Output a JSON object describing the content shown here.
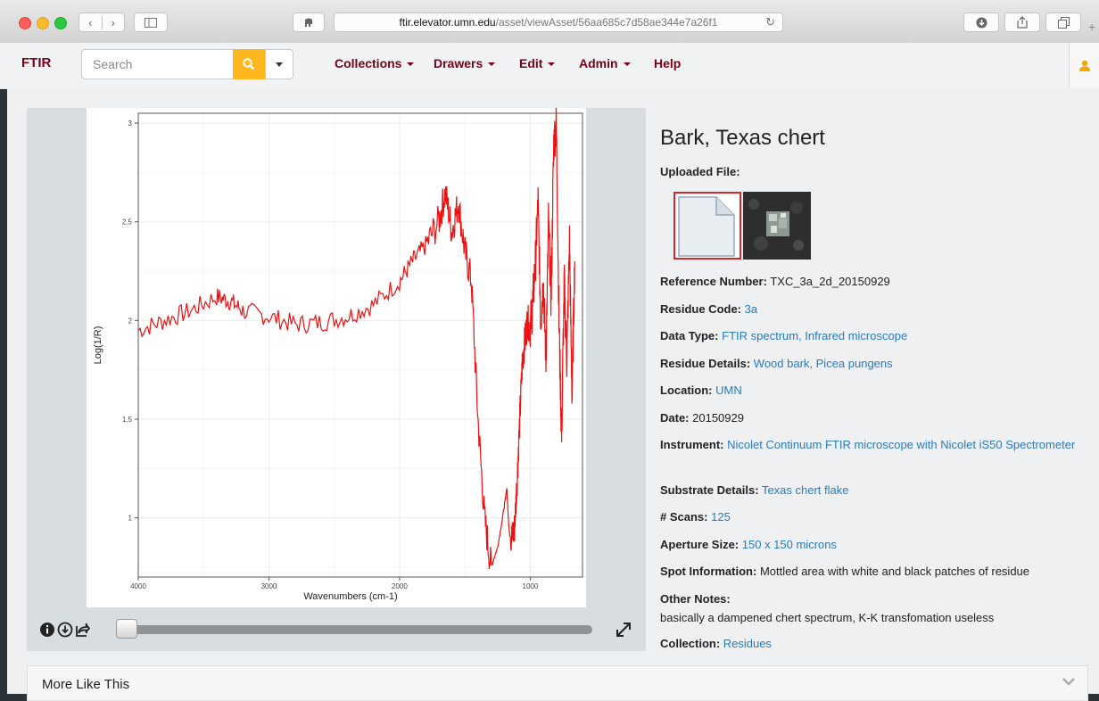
{
  "browser": {
    "url_domain": "ftir.elevator.umn.edu",
    "url_path": "/asset/viewAsset/56aa685c7d58ae344e7a26f1",
    "back_glyph": "‹",
    "forward_glyph": "›",
    "reload_glyph": "↻",
    "new_tab_glyph": "+"
  },
  "nav": {
    "brand": "FTIR",
    "search_placeholder": "Search",
    "menu": [
      {
        "label": "Collections",
        "dropdown": true
      },
      {
        "label": "Drawers",
        "dropdown": true
      },
      {
        "label": "Edit",
        "dropdown": true
      },
      {
        "label": "Admin",
        "dropdown": true
      },
      {
        "label": "Help",
        "dropdown": false
      }
    ],
    "brand_color": "#7a0019",
    "search_button_color": "#ffb71e"
  },
  "asset": {
    "title": "Bark, Texas chert",
    "uploaded_file_label": "Uploaded File:",
    "fields": [
      {
        "key": "Reference Number:",
        "value": "TXC_3a_2d_20150929",
        "link": false
      },
      {
        "key": "Residue Code:",
        "value": "3a",
        "link": true
      },
      {
        "key": "Data Type:",
        "value": "FTIR spectrum, Infrared microscope",
        "link": true
      },
      {
        "key": "Residue Details:",
        "value": "Wood bark, Picea pungens",
        "link": true
      },
      {
        "key": "Location:",
        "value": "UMN",
        "link": true
      },
      {
        "key": "Date:",
        "value": "20150929",
        "link": false
      },
      {
        "key": "Instrument:",
        "value": "Nicolet Continuum FTIR microscope with Nicolet iS50 Spectrometer",
        "link": true
      },
      {
        "key": "Substrate Details:",
        "value": "Texas chert flake",
        "link": true
      },
      {
        "key": "# Scans:",
        "value": "125",
        "link": true
      },
      {
        "key": "Aperture Size:",
        "value": "150 x 150 microns",
        "link": true
      },
      {
        "key": "Spot Information:",
        "value": "Mottled area with white and black patches of residue",
        "link": false
      },
      {
        "key": "Other Notes:",
        "value": "basically a dampened chert spectrum, K-K transfomation useless",
        "link": false
      },
      {
        "key": "Collection:",
        "value": "Residues",
        "link": true
      }
    ],
    "link_color": "#2b7bbf"
  },
  "viewer": {
    "slider_position": 0
  },
  "more_like_this": {
    "label": "More Like This"
  },
  "chart_data": {
    "type": "line",
    "xlabel": "Wavenumbers (cm-1)",
    "ylabel": "Log(1/R)",
    "xlim": [
      4000,
      600
    ],
    "x_reversed": true,
    "ylim": [
      0.7,
      3.05
    ],
    "xticks": [
      4000,
      3000,
      2000,
      1000
    ],
    "yticks": [
      1.0,
      1.5,
      2.0,
      2.5,
      3.0
    ],
    "grid": true,
    "legend": "none",
    "series": [
      {
        "color": "#ee1111",
        "x": [
          4000,
          3800,
          3600,
          3400,
          3300,
          3200,
          3000,
          2800,
          2600,
          2400,
          2200,
          2000,
          1900,
          1800,
          1700,
          1650,
          1600,
          1550,
          1500,
          1450,
          1400,
          1350,
          1300,
          1250,
          1200,
          1180,
          1160,
          1140,
          1120,
          1100,
          1080,
          1060,
          1040,
          1020,
          1000,
          980,
          960,
          940,
          920,
          900,
          880,
          860,
          840,
          820,
          800,
          780,
          760,
          740,
          720,
          700,
          680,
          660
        ],
        "y": [
          1.95,
          2.0,
          2.05,
          2.12,
          2.1,
          2.05,
          2.02,
          1.98,
          1.99,
          2.02,
          2.08,
          2.2,
          2.3,
          2.38,
          2.5,
          2.65,
          2.45,
          2.6,
          2.35,
          2.2,
          1.5,
          1.0,
          0.75,
          0.85,
          1.05,
          1.15,
          0.92,
          0.9,
          0.95,
          1.2,
          1.5,
          1.8,
          1.9,
          2.0,
          1.95,
          2.1,
          2.3,
          2.6,
          2.0,
          2.2,
          1.8,
          2.5,
          2.1,
          2.9,
          3.0,
          2.0,
          1.4,
          2.2,
          1.8,
          2.4,
          1.6,
          2.3
        ]
      }
    ]
  }
}
